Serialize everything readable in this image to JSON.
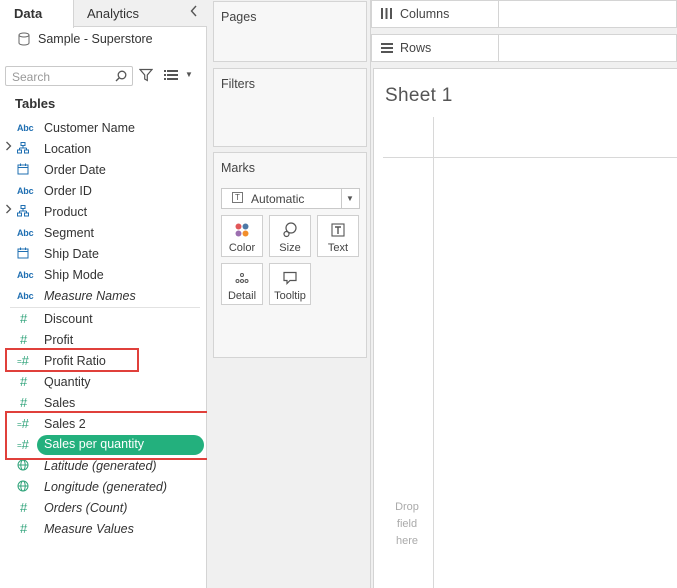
{
  "data_pane": {
    "tabs": {
      "data": "Data",
      "analytics": "Analytics"
    },
    "data_source": "Sample - Superstore",
    "search_placeholder": "Search",
    "tables_heading": "Tables",
    "dimensions": [
      {
        "type": "Abc",
        "name": "Customer Name",
        "expandable": false,
        "italic": false
      },
      {
        "type": "hierarchy",
        "name": "Location",
        "expandable": true,
        "italic": false
      },
      {
        "type": "date",
        "name": "Order Date",
        "expandable": false,
        "italic": false
      },
      {
        "type": "Abc",
        "name": "Order ID",
        "expandable": false,
        "italic": false
      },
      {
        "type": "hierarchy",
        "name": "Product",
        "expandable": true,
        "italic": false
      },
      {
        "type": "Abc",
        "name": "Segment",
        "expandable": false,
        "italic": false
      },
      {
        "type": "date",
        "name": "Ship Date",
        "expandable": false,
        "italic": false
      },
      {
        "type": "Abc",
        "name": "Ship Mode",
        "expandable": false,
        "italic": false
      },
      {
        "type": "Abc",
        "name": "Measure Names",
        "expandable": false,
        "italic": true
      }
    ],
    "measures": [
      {
        "type": "number",
        "name": "Discount",
        "italic": false
      },
      {
        "type": "number",
        "name": "Profit",
        "italic": false
      },
      {
        "type": "calc",
        "name": "Profit Ratio",
        "italic": false,
        "highlighted": true
      },
      {
        "type": "number",
        "name": "Quantity",
        "italic": false
      },
      {
        "type": "number",
        "name": "Sales",
        "italic": false
      },
      {
        "type": "calc",
        "name": "Sales 2",
        "italic": false,
        "highlighted": true
      },
      {
        "type": "calc",
        "name": "Sales per quantity",
        "italic": false,
        "highlighted": true,
        "selected": true
      },
      {
        "type": "geo",
        "name": "Latitude (generated)",
        "italic": true
      },
      {
        "type": "geo",
        "name": "Longitude (generated)",
        "italic": true
      },
      {
        "type": "number",
        "name": "Orders (Count)",
        "italic": true
      },
      {
        "type": "number",
        "name": "Measure Values",
        "italic": true
      }
    ],
    "type_glyphs": {
      "Abc": "Abc",
      "number": "#",
      "calc": "=#"
    },
    "colors": {
      "highlight": "#e0403b",
      "selected_pill": "#23b07d",
      "dimension": "#1f6fb2",
      "measure": "#2fa37a"
    }
  },
  "shelves": {
    "pages": "Pages",
    "filters": "Filters",
    "marks": {
      "title": "Marks",
      "mark_type": "Automatic",
      "buttons": [
        "Color",
        "Size",
        "Text",
        "Detail",
        "Tooltip"
      ]
    },
    "columns": "Columns",
    "rows": "Rows"
  },
  "view": {
    "sheet_title": "Sheet 1",
    "drop_hint": [
      "Drop",
      "field",
      "here"
    ]
  }
}
